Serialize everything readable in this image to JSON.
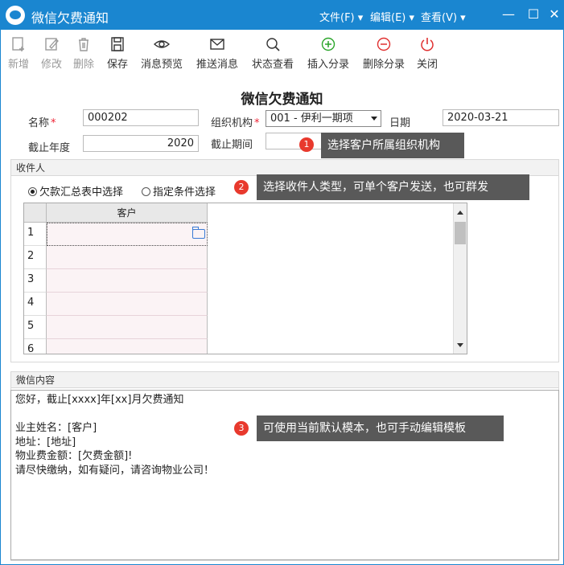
{
  "window": {
    "title": "微信欠费通知",
    "menus": [
      "文件(F)",
      "编辑(E)",
      "查看(V)"
    ],
    "controls": {
      "minimize": "—",
      "maximize": "☐",
      "close": "✕"
    }
  },
  "toolbar": {
    "new": "新增",
    "edit": "修改",
    "delete": "删除",
    "save": "保存",
    "preview": "消息预览",
    "send": "推送消息",
    "status": "状态查看",
    "insert_entry": "插入分录",
    "delete_entry": "删除分录",
    "close": "关闭"
  },
  "form": {
    "title": "微信欠费通知",
    "name_label": "名称",
    "name_value": "000202",
    "org_label": "组织机构",
    "org_value": "001 - 伊利一期项",
    "date_label": "日期",
    "date_value": "2020-03-21",
    "year_label": "截止年度",
    "year_value": "2020",
    "period_label": "截止期间",
    "period_value": "",
    "required_mark": "*"
  },
  "recipients": {
    "panel_title": "收件人",
    "options": [
      "欠款汇总表中选择",
      "指定条件选择"
    ],
    "selected_index": 0,
    "grid": {
      "column": "客户",
      "rows": [
        "1",
        "2",
        "3",
        "4",
        "5",
        "6"
      ]
    }
  },
  "content": {
    "panel_title": "微信内容",
    "text": "您好，截止[xxxx]年[xx]月欠费通知\n\n业主姓名：[客户]\n地址：[地址]\n物业费金额：[欠费金额]!\n请尽快缴纳，如有疑问，请咨询物业公司！"
  },
  "tips": [
    {
      "num": "1",
      "text": "选择客户所属组织机构"
    },
    {
      "num": "2",
      "text": "选择收件人类型，可单个客户发送，也可群发"
    },
    {
      "num": "3",
      "text": "可使用当前默认模本，也可手动编辑模板"
    }
  ],
  "colors": {
    "titlebar": "#1a86d0",
    "tip_bg": "#595959",
    "badge": "#e8392d",
    "required": "#e23",
    "green": "#2aa52a",
    "red": "#e03030"
  }
}
